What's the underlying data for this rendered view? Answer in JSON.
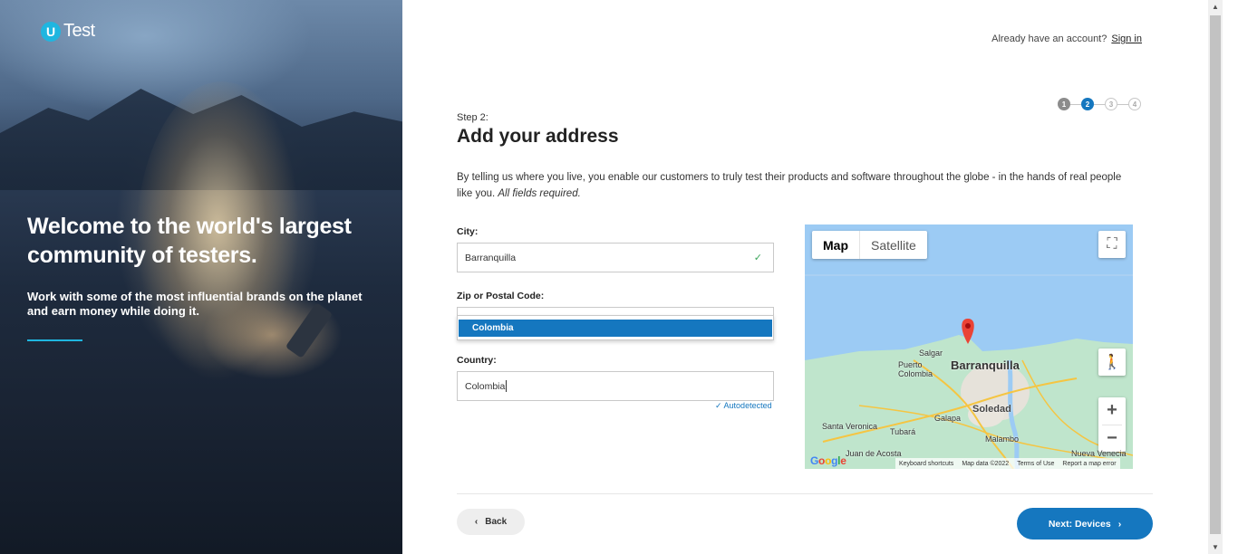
{
  "hero": {
    "logo_letter": "U",
    "logo_text": "Test",
    "title": "Welcome to the world's largest community of testers.",
    "subtitle": "Work with some of the most influential brands on the planet and earn money while doing it."
  },
  "header": {
    "account_prompt": "Already have an account?",
    "signin_label": "Sign in"
  },
  "stepper": {
    "steps": [
      "1",
      "2",
      "3",
      "4"
    ],
    "current": 2
  },
  "form": {
    "step_label": "Step 2:",
    "title": "Add your address",
    "intro": "By telling us where you live, you enable our customers to truly test their products and software throughout the globe - in the hands of real people like you.",
    "intro_emphasis": "All fields required.",
    "city": {
      "label": "City:",
      "value": "Barranquilla"
    },
    "zip": {
      "label": "Zip or Postal Code:",
      "value": ""
    },
    "autocomplete": {
      "option": "Colombia"
    },
    "country": {
      "label": "Country:",
      "value": "Colombia",
      "note": "✓ Autodetected"
    }
  },
  "map": {
    "tabs": [
      "Map",
      "Satellite"
    ],
    "active_tab": "Map",
    "labels": {
      "barranquilla": "Barranquilla",
      "salgar": "Salgar",
      "puerto_colombia": "Puerto\nColombia",
      "soledad": "Soledad",
      "galapa": "Galapa",
      "tubara": "Tubará",
      "malambo": "Malambo",
      "santa_veronica": "Santa Veronica",
      "juan_de_acosta": "Juan de Acosta",
      "nueva_venecia": "Nueva Venecia"
    },
    "footer": [
      "Keyboard shortcuts",
      "Map data ©2022",
      "Terms of Use",
      "Report a map error"
    ],
    "google": "Google"
  },
  "nav": {
    "back_label": "Back",
    "next_label": "Next: Devices"
  },
  "colors": {
    "accent": "#1577bf",
    "logo": "#1fb6e0",
    "map_water": "#9ccbf4",
    "map_land": "#bfe5cc"
  }
}
